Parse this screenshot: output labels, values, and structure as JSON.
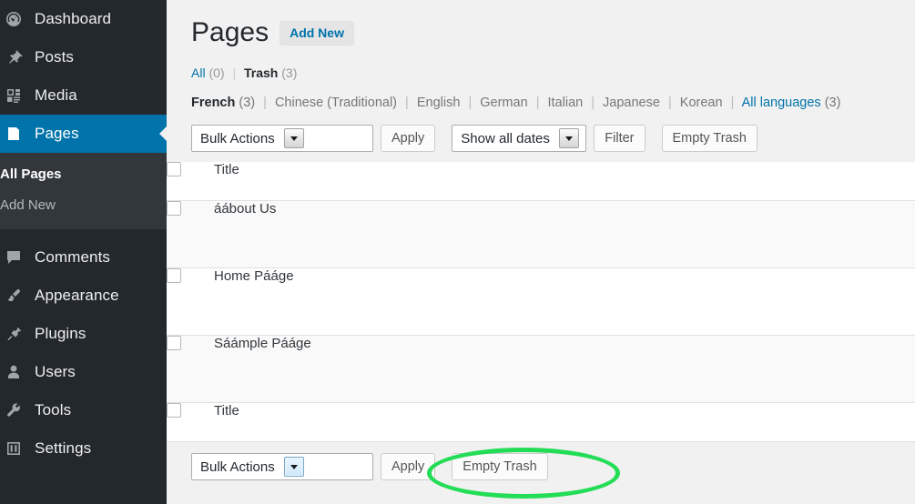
{
  "sidebar": {
    "items": [
      {
        "label": "Dashboard",
        "icon": "dashboard-icon",
        "current": false
      },
      {
        "label": "Posts",
        "icon": "pin-icon",
        "current": false
      },
      {
        "label": "Media",
        "icon": "media-icon",
        "current": false
      },
      {
        "label": "Pages",
        "icon": "page-icon",
        "current": true
      },
      {
        "label": "Comments",
        "icon": "comment-icon",
        "current": false
      },
      {
        "label": "Appearance",
        "icon": "brush-icon",
        "current": false
      },
      {
        "label": "Plugins",
        "icon": "plug-icon",
        "current": false
      },
      {
        "label": "Users",
        "icon": "user-icon",
        "current": false
      },
      {
        "label": "Tools",
        "icon": "wrench-icon",
        "current": false
      },
      {
        "label": "Settings",
        "icon": "settings-icon",
        "current": false
      }
    ],
    "submenu": [
      {
        "label": "All Pages",
        "current": true
      },
      {
        "label": "Add New",
        "current": false
      }
    ]
  },
  "header": {
    "title": "Pages",
    "add_new_label": "Add New"
  },
  "status_filters": {
    "all_label": "All",
    "all_count": "(0)",
    "separator": "|",
    "trash_label": "Trash",
    "trash_count": "(3)"
  },
  "language_filters": {
    "separator": "|",
    "items": [
      {
        "label": "French",
        "count": "(3)",
        "current": true,
        "link": false
      },
      {
        "label": "Chinese (Traditional)",
        "count": "",
        "current": false,
        "link": false
      },
      {
        "label": "English",
        "count": "",
        "current": false,
        "link": false
      },
      {
        "label": "German",
        "count": "",
        "current": false,
        "link": false
      },
      {
        "label": "Italian",
        "count": "",
        "current": false,
        "link": false
      },
      {
        "label": "Japanese",
        "count": "",
        "current": false,
        "link": false
      },
      {
        "label": "Korean",
        "count": "",
        "current": false,
        "link": false
      },
      {
        "label": "All languages",
        "count": "(3)",
        "current": false,
        "link": true
      }
    ]
  },
  "toolbar_top": {
    "bulk_actions_value": "Bulk Actions",
    "apply_label": "Apply",
    "dates_value": "Show all dates",
    "filter_label": "Filter",
    "empty_trash_label": "Empty Trash"
  },
  "toolbar_bottom": {
    "bulk_actions_value": "Bulk Actions",
    "apply_label": "Apply",
    "empty_trash_label": "Empty Trash"
  },
  "table": {
    "header_title": "Title",
    "footer_title": "Title",
    "rows": [
      {
        "title": "áábout Us"
      },
      {
        "title": "Home Pááge"
      },
      {
        "title": "Sáámple Pááge"
      }
    ]
  },
  "annotation": {
    "shape": "ellipse",
    "color": "#22dd55",
    "target": "Empty Trash"
  },
  "colors": {
    "sidebar_bg": "#23282d",
    "submenu_bg": "#32373c",
    "accent_blue": "#0073aa",
    "page_bg": "#f1f1f1",
    "annotation_green": "#22dd55"
  }
}
